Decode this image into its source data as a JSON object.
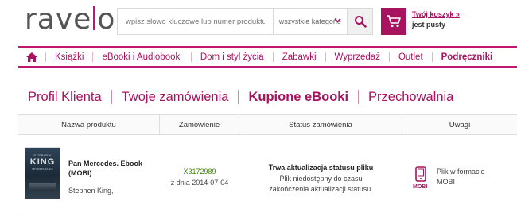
{
  "header": {
    "logo_left": "rave",
    "logo_right": "o",
    "search": {
      "placeholder": "wpisz słowo kluczowe lub numer produktu",
      "category": "wszystkie kategorie"
    },
    "cart": {
      "title": "Twój koszyk »",
      "status": "jest pusty"
    }
  },
  "nav": {
    "items": [
      {
        "label": "Książki"
      },
      {
        "label": "eBooki i Audiobooki"
      },
      {
        "label": "Dom i styl życia"
      },
      {
        "label": "Zabawki"
      },
      {
        "label": "Wyprzedaż"
      },
      {
        "label": "Outlet"
      },
      {
        "label": "Podręczniki"
      }
    ]
  },
  "account_tabs": [
    {
      "label": "Profil Klienta"
    },
    {
      "label": "Twoje zamówienia"
    },
    {
      "label": "Kupione eBooki"
    },
    {
      "label": "Przechowalnia"
    }
  ],
  "table": {
    "headers": [
      "Nazwa produktu",
      "Zamówienie",
      "Status zamówienia",
      "Uwagi"
    ],
    "rows": [
      {
        "cover": {
          "author": "STEPHEN",
          "name": "KING",
          "subtitle": "MR MERCEDES"
        },
        "title_line1": "Pan Mercedes. Ebook",
        "title_line2": "(MOBI)",
        "author": "Stephen King,",
        "order_number": "X3172989",
        "order_date": "z dnia 2014-07-04",
        "status_title": "Trwa aktualizacja statusu pliku",
        "status_line1": "Plik niedostępny do czasu",
        "status_line2": "zakończenia aktualizacji statusu.",
        "format_label": "MOBI",
        "note_line1": "Plik w formacie",
        "note_line2": "MOBI"
      }
    ]
  },
  "colors": {
    "brand": "#a8125f",
    "link_green": "#3d8a00"
  }
}
